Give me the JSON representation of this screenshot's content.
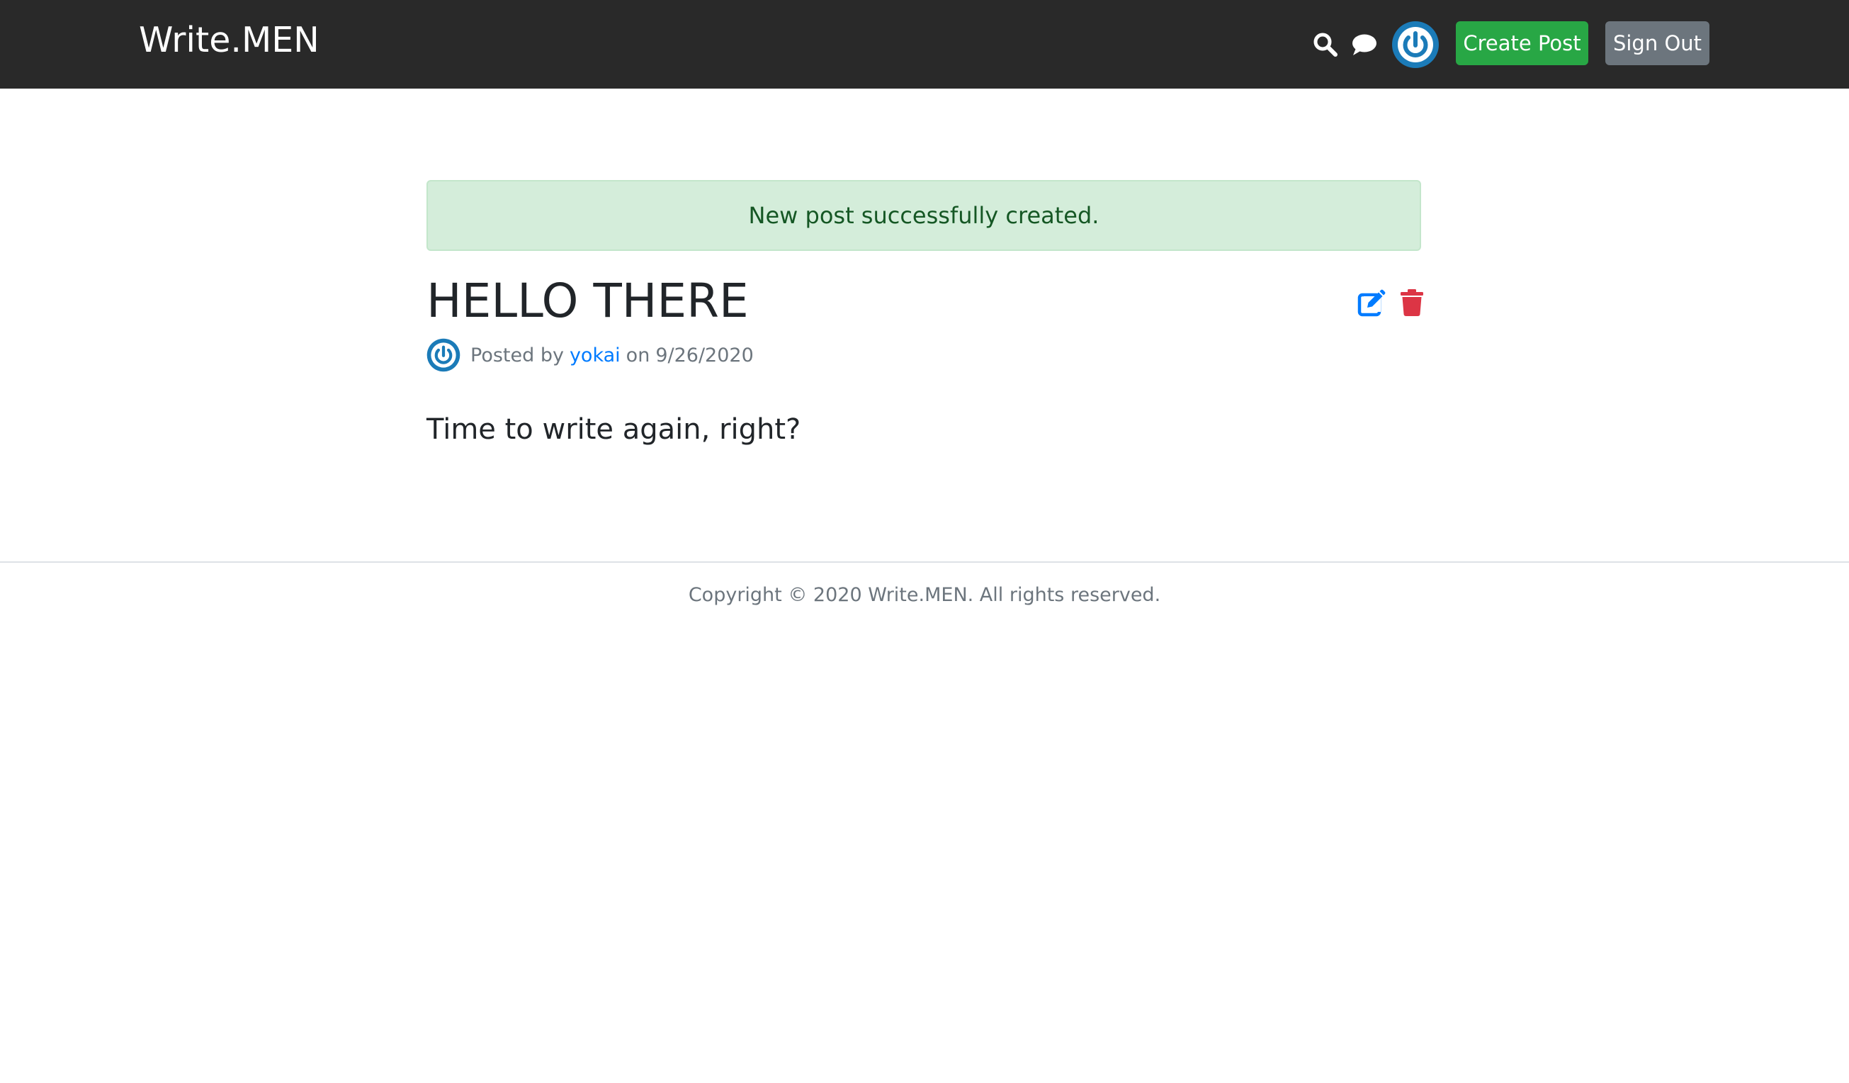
{
  "navbar": {
    "brand": "Write.MEN",
    "icons": [
      "search-icon",
      "chat-icon",
      "avatar"
    ],
    "create_label": "Create Post",
    "signout_label": "Sign Out"
  },
  "alert": {
    "message": "New post successfully created."
  },
  "post": {
    "title": "HELLO THERE",
    "posted_by_prefix": "Posted by",
    "author": "yokai",
    "date_prefix": "on",
    "date": "9/26/2020",
    "body": "Time to write again, right?",
    "actions": [
      "edit-icon",
      "trash-icon"
    ]
  },
  "footer": {
    "text": "Copyright © 2020 Write.MEN. All rights reserved."
  },
  "colors": {
    "navbar_bg": "#292929",
    "create_button": "#28a745",
    "signout_button": "#6c757d",
    "alert_bg": "#d4edda",
    "alert_text": "#155724",
    "link": "#007bff",
    "edit": "#007bff",
    "delete": "#dc3545",
    "avatar": "#1b7bb8"
  }
}
